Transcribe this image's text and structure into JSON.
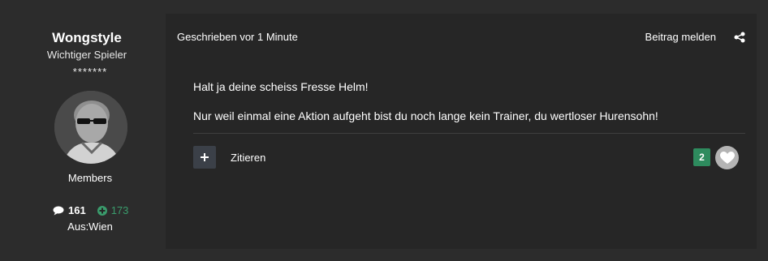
{
  "author": {
    "name": "Wongstyle",
    "rank": "Wichtiger Spieler",
    "stars": "*******",
    "group": "Members",
    "posts": "161",
    "reputation": "173",
    "location": "Aus:Wien"
  },
  "post": {
    "meta": "Geschrieben vor 1 Minute",
    "report_label": "Beitrag melden",
    "body": [
      "Halt ja deine scheiss Fresse Helm!",
      "Nur weil einmal eine Aktion aufgeht bist du noch lange kein Trainer, du wertloser Hurensohn!"
    ],
    "quote_label": "Zitieren",
    "reaction_count": "2"
  },
  "colors": {
    "background": "#2c2c2c",
    "post_background": "#262626",
    "accent_green": "#2e8b5e",
    "reputation_green": "#3a9c6c"
  },
  "icons": {
    "posts": "speech-bubble-icon",
    "reputation": "plus-circle-icon",
    "share": "share-icon",
    "multiquote": "plus-icon",
    "reaction": "heart-icon"
  }
}
